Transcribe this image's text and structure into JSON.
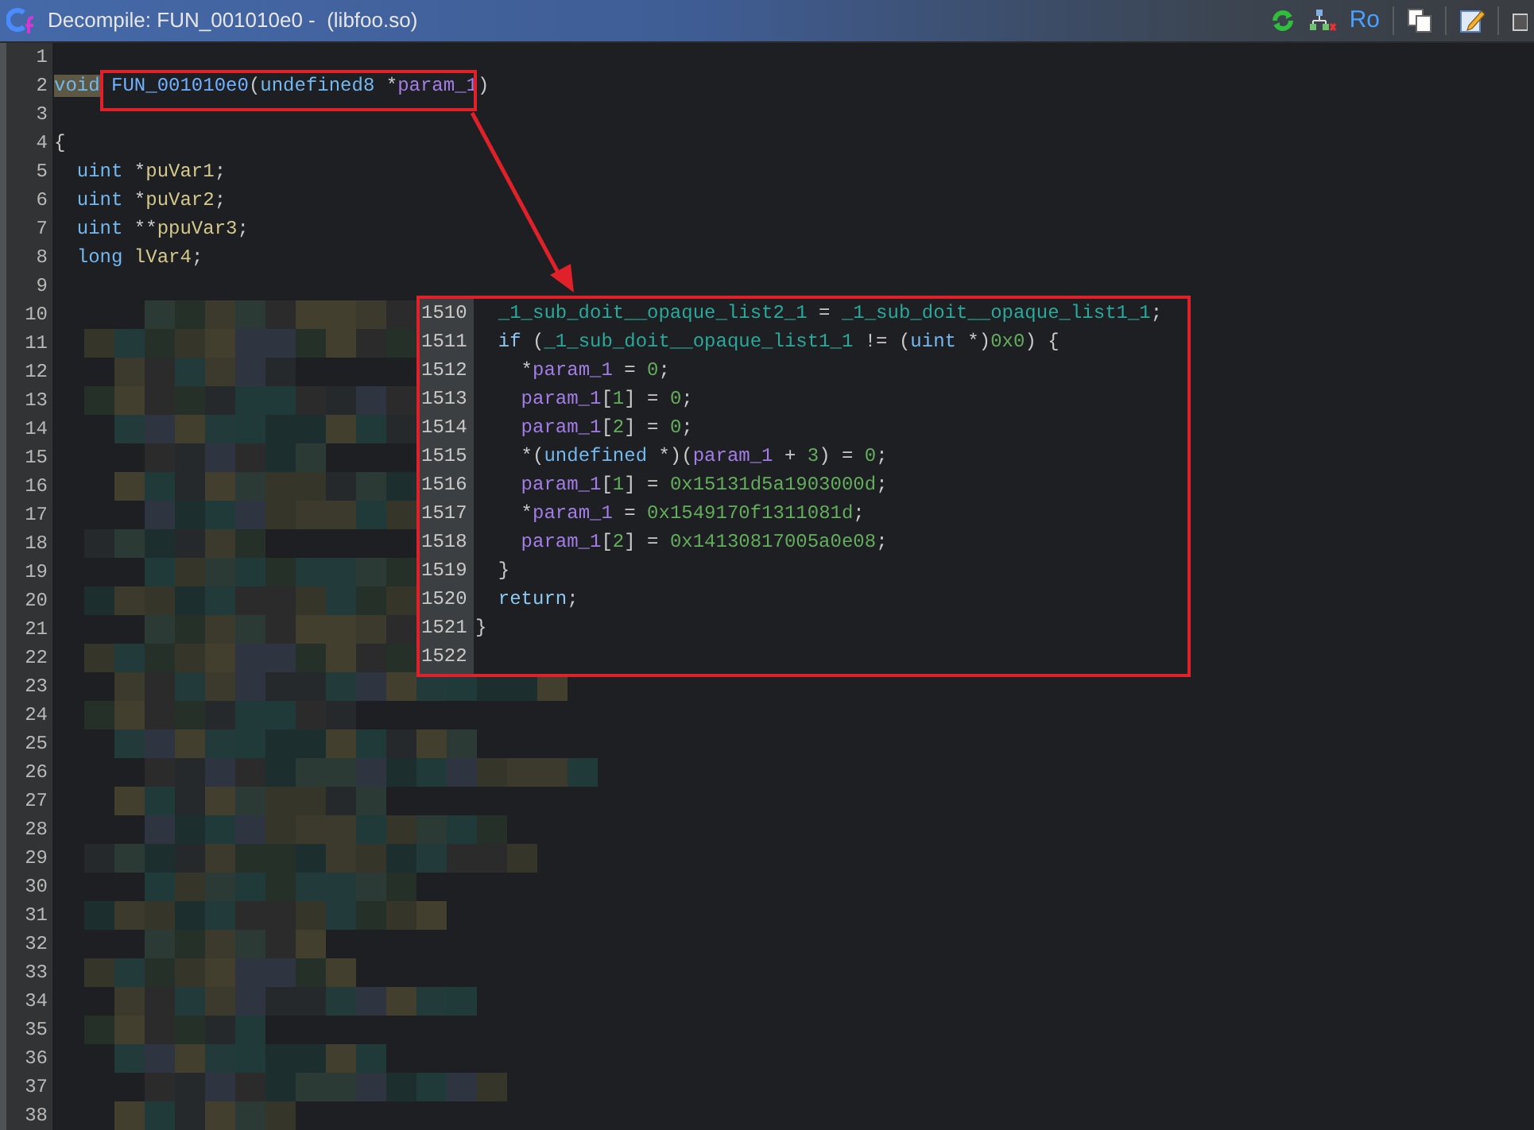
{
  "window": {
    "title": "Decompile: FUN_001010e0 -  (libfoo.so)"
  },
  "toolbar": {
    "label": "Ro"
  },
  "code": [
    {
      "number": "1",
      "redacted": false
    },
    {
      "number": "2",
      "redacted": false,
      "tokens": [
        {
          "text": "void",
          "kind": "type",
          "highlighted": true
        },
        {
          "text": " FUN_001010e0",
          "kind": "func"
        },
        {
          "text": "(",
          "kind": "punct"
        },
        {
          "text": "undefined8",
          "kind": "type"
        },
        {
          "text": " *",
          "kind": "punct"
        },
        {
          "text": "param_1",
          "kind": "param"
        },
        {
          "text": ")",
          "kind": "punct"
        }
      ]
    },
    {
      "number": "3",
      "redacted": false
    },
    {
      "number": "4",
      "redacted": false,
      "tokens": [
        {
          "text": "{",
          "kind": "punct"
        }
      ]
    },
    {
      "number": "5",
      "redacted": false,
      "tokens": [
        {
          "text": "  uint",
          "kind": "type"
        },
        {
          "text": " *",
          "kind": "punct"
        },
        {
          "text": "puVar1",
          "kind": "var"
        },
        {
          "text": ";",
          "kind": "punct"
        }
      ]
    },
    {
      "number": "6",
      "redacted": false,
      "tokens": [
        {
          "text": "  uint",
          "kind": "type"
        },
        {
          "text": " *",
          "kind": "punct"
        },
        {
          "text": "puVar2",
          "kind": "var"
        },
        {
          "text": ";",
          "kind": "punct"
        }
      ]
    },
    {
      "number": "7",
      "redacted": false,
      "tokens": [
        {
          "text": "  uint",
          "kind": "type"
        },
        {
          "text": " **",
          "kind": "punct"
        },
        {
          "text": "ppuVar3",
          "kind": "var"
        },
        {
          "text": ";",
          "kind": "punct"
        }
      ]
    },
    {
      "number": "8",
      "redacted": false,
      "tokens": [
        {
          "text": "  long",
          "kind": "type"
        },
        {
          "text": " lVar4",
          "kind": "var"
        },
        {
          "text": ";",
          "kind": "punct"
        }
      ]
    },
    {
      "number": "9",
      "redacted": false
    },
    {
      "number": "10",
      "redacted": true
    },
    {
      "number": "11",
      "redacted": true
    },
    {
      "number": "12",
      "redacted": true
    },
    {
      "number": "13",
      "redacted": true
    },
    {
      "number": "14",
      "redacted": true
    },
    {
      "number": "15",
      "redacted": true
    },
    {
      "number": "16",
      "redacted": true
    },
    {
      "number": "17",
      "redacted": true
    },
    {
      "number": "18",
      "redacted": true
    },
    {
      "number": "19",
      "redacted": true
    },
    {
      "number": "20",
      "redacted": true
    },
    {
      "number": "21",
      "redacted": true
    },
    {
      "number": "22",
      "redacted": true
    },
    {
      "number": "23",
      "redacted": true
    },
    {
      "number": "24",
      "redacted": true
    },
    {
      "number": "25",
      "redacted": true
    },
    {
      "number": "26",
      "redacted": true
    },
    {
      "number": "27",
      "redacted": true
    },
    {
      "number": "28",
      "redacted": true
    },
    {
      "number": "29",
      "redacted": true
    },
    {
      "number": "30",
      "redacted": true
    },
    {
      "number": "31",
      "redacted": true
    },
    {
      "number": "32",
      "redacted": true
    },
    {
      "number": "33",
      "redacted": true
    },
    {
      "number": "34",
      "redacted": true
    },
    {
      "number": "35",
      "redacted": true
    },
    {
      "number": "36",
      "redacted": true
    },
    {
      "number": "37",
      "redacted": true
    },
    {
      "number": "38",
      "redacted": true
    }
  ],
  "callout": [
    {
      "number": "1510",
      "tokens": [
        {
          "text": "  _1_sub_doit__opaque_list2_1",
          "kind": "global"
        },
        {
          "text": " = ",
          "kind": "punct"
        },
        {
          "text": "_1_sub_doit__opaque_list1_1",
          "kind": "global"
        },
        {
          "text": ";",
          "kind": "punct"
        }
      ]
    },
    {
      "number": "1511",
      "tokens": [
        {
          "text": "  if",
          "kind": "keyword"
        },
        {
          "text": " (",
          "kind": "punct"
        },
        {
          "text": "_1_sub_doit__opaque_list1_1",
          "kind": "global"
        },
        {
          "text": " != (",
          "kind": "punct"
        },
        {
          "text": "uint",
          "kind": "type"
        },
        {
          "text": " *)",
          "kind": "punct"
        },
        {
          "text": "0x0",
          "kind": "number"
        },
        {
          "text": ") {",
          "kind": "punct"
        }
      ]
    },
    {
      "number": "1512",
      "tokens": [
        {
          "text": "    *",
          "kind": "punct"
        },
        {
          "text": "param_1",
          "kind": "param"
        },
        {
          "text": " = ",
          "kind": "punct"
        },
        {
          "text": "0",
          "kind": "number"
        },
        {
          "text": ";",
          "kind": "punct"
        }
      ]
    },
    {
      "number": "1513",
      "tokens": [
        {
          "text": "    param_1",
          "kind": "param"
        },
        {
          "text": "[",
          "kind": "punct"
        },
        {
          "text": "1",
          "kind": "number"
        },
        {
          "text": "] = ",
          "kind": "punct"
        },
        {
          "text": "0",
          "kind": "number"
        },
        {
          "text": ";",
          "kind": "punct"
        }
      ]
    },
    {
      "number": "1514",
      "tokens": [
        {
          "text": "    param_1",
          "kind": "param"
        },
        {
          "text": "[",
          "kind": "punct"
        },
        {
          "text": "2",
          "kind": "number"
        },
        {
          "text": "] = ",
          "kind": "punct"
        },
        {
          "text": "0",
          "kind": "number"
        },
        {
          "text": ";",
          "kind": "punct"
        }
      ]
    },
    {
      "number": "1515",
      "tokens": [
        {
          "text": "    *(",
          "kind": "punct"
        },
        {
          "text": "undefined",
          "kind": "type"
        },
        {
          "text": " *)(",
          "kind": "punct"
        },
        {
          "text": "param_1",
          "kind": "param"
        },
        {
          "text": " + ",
          "kind": "punct"
        },
        {
          "text": "3",
          "kind": "number"
        },
        {
          "text": ") = ",
          "kind": "punct"
        },
        {
          "text": "0",
          "kind": "number"
        },
        {
          "text": ";",
          "kind": "punct"
        }
      ]
    },
    {
      "number": "1516",
      "tokens": [
        {
          "text": "    param_1",
          "kind": "param"
        },
        {
          "text": "[",
          "kind": "punct"
        },
        {
          "text": "1",
          "kind": "number"
        },
        {
          "text": "] = ",
          "kind": "punct"
        },
        {
          "text": "0x15131d5a1903000d",
          "kind": "number"
        },
        {
          "text": ";",
          "kind": "punct"
        }
      ]
    },
    {
      "number": "1517",
      "tokens": [
        {
          "text": "    *",
          "kind": "punct"
        },
        {
          "text": "param_1",
          "kind": "param"
        },
        {
          "text": " = ",
          "kind": "punct"
        },
        {
          "text": "0x1549170f1311081d",
          "kind": "number"
        },
        {
          "text": ";",
          "kind": "punct"
        }
      ]
    },
    {
      "number": "1518",
      "tokens": [
        {
          "text": "    param_1",
          "kind": "param"
        },
        {
          "text": "[",
          "kind": "punct"
        },
        {
          "text": "2",
          "kind": "number"
        },
        {
          "text": "] = ",
          "kind": "punct"
        },
        {
          "text": "0x14130817005a0e08",
          "kind": "number"
        },
        {
          "text": ";",
          "kind": "punct"
        }
      ]
    },
    {
      "number": "1519",
      "tokens": [
        {
          "text": "  }",
          "kind": "punct"
        }
      ]
    },
    {
      "number": "1520",
      "tokens": [
        {
          "text": "  return",
          "kind": "keyword"
        },
        {
          "text": ";",
          "kind": "punct"
        }
      ]
    },
    {
      "number": "1521",
      "tokens": [
        {
          "text": "}",
          "kind": "punct"
        }
      ]
    },
    {
      "number": "1522"
    }
  ]
}
